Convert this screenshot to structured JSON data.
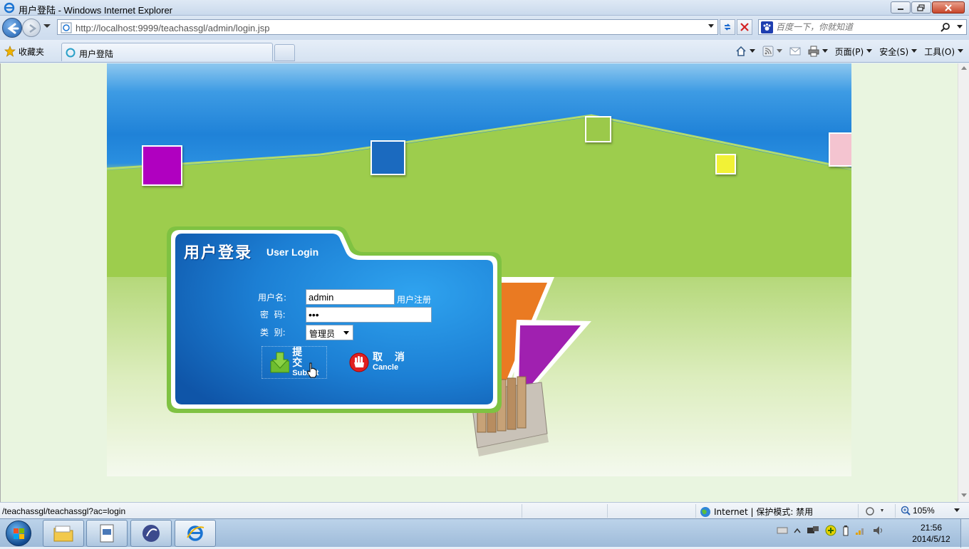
{
  "window": {
    "title": "用户登陆 - Windows Internet Explorer",
    "controls": {
      "minimize": "minimize",
      "maximize": "maximize",
      "close": "close"
    }
  },
  "address_bar": {
    "url": "http://localhost:9999/teachassgl/admin/login.jsp"
  },
  "search": {
    "placeholder": "百度一下，你就知道"
  },
  "favorites": {
    "label": "收藏夹"
  },
  "tab": {
    "label": "用户登陆"
  },
  "command_bar": {
    "page": "页面(P)",
    "safety": "安全(S)",
    "tools": "工具(O)"
  },
  "login": {
    "title_cn": "用户登录",
    "title_en": "User Login",
    "username_label": "用户名:",
    "username_value": "admin",
    "register_link": "用户注册",
    "password_label": "密  码:",
    "password_value": "•••",
    "category_label": "类  别:",
    "category_value": "管理员",
    "submit_cn": "提 交",
    "submit_en": "Submit",
    "cancel_cn": "取 消",
    "cancel_en": "Cancle"
  },
  "status_bar": {
    "url": "/teachassgl/teachassgl?ac=login",
    "zone": "Internet | 保护模式: 禁用",
    "zoom": "105%"
  },
  "taskbar": {
    "time": "21:56",
    "date": "2014/5/12"
  },
  "colors": {
    "square_colors": [
      "#b000c0",
      "#1b6abf",
      "#9bc94a",
      "#f2f236",
      "#f4c4d0"
    ],
    "panel_blue": "#1f7fd6",
    "panel_border": "#7fc242"
  }
}
